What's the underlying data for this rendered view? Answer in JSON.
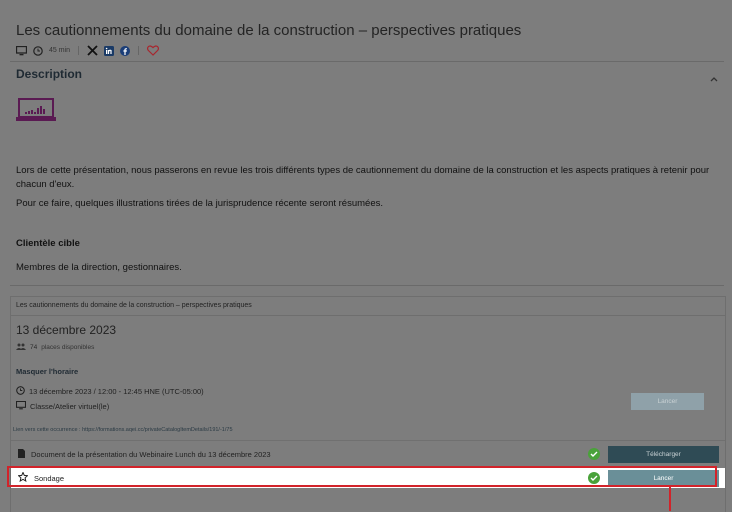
{
  "course": {
    "title": "Les cautionnements du domaine de la construction – perspectives pratiques",
    "duration": "45 min"
  },
  "description": {
    "heading": "Description",
    "paragraph1": "Lors de cette présentation, nous passerons en revue les trois différents types de cautionnement du domaine de la construction et les aspects pratiques à retenir pour chacun d'eux.",
    "paragraph2": "Pour ce faire, quelques illustrations tirées de la jurisprudence récente seront résumées.",
    "target_heading": "Clientèle cible",
    "target_text": "Membres de la direction, gestionnaires."
  },
  "session": {
    "card_title": "Les cautionnements du domaine de la construction – perspectives pratiques",
    "date": "13 décembre 2023",
    "places_count": "74",
    "places_label": "places disponibles",
    "toggle_schedule": "Masquer l'horaire",
    "schedule_time": "13 décembre 2023 / 12:00 - 12:45 HNE (UTC-05:00)",
    "schedule_location": "Classe/Atelier virtuel(le)",
    "launch_label": "Lancer",
    "occurrence_link": "Lien vers cette occurrence : https://formations.aqei.cc/privateCatalogItemDetails/191/-1/75"
  },
  "items": [
    {
      "label": "Document de la présentation du Webinaire Lunch du 13 décembre 2023",
      "button": "Télécharger",
      "icon": "document-icon"
    },
    {
      "label": "Sondage",
      "button": "Lancer",
      "icon": "survey-star-icon"
    }
  ],
  "colors": {
    "overlay": "#7d7d7d",
    "accent_dark": "#2f4b55",
    "accent_light": "#6a8f98",
    "check": "#4aa23a",
    "highlight": "#d2232a"
  }
}
